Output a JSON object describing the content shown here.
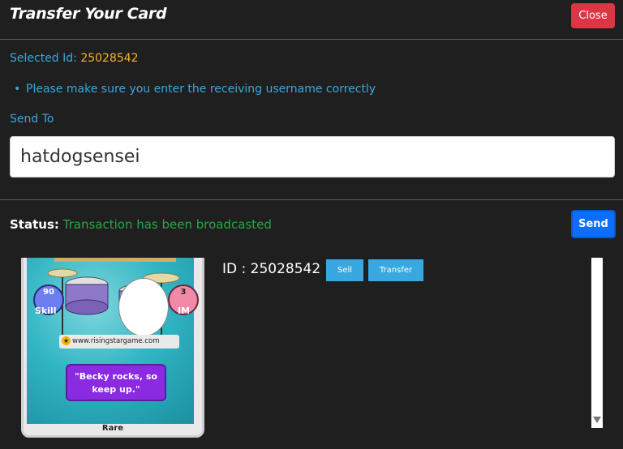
{
  "header": {
    "title": "Transfer Your Card",
    "close_label": "Close"
  },
  "form": {
    "selected_id_label": "Selected Id:",
    "selected_id_value": "25028542",
    "notice": "Please make sure you enter the receiving username correctly",
    "send_to_label": "Send To",
    "recipient_value": "hatdogsensei"
  },
  "footer": {
    "status_label": "Status:",
    "status_message": "Transaction has been broadcasted",
    "send_label": "Send"
  },
  "card": {
    "skill_value": "90",
    "skill_label": "Skill",
    "im_value": "3",
    "im_label": "IM",
    "website": "www.risingstargame.com",
    "quote": "\"Becky rocks, so keep up.\"",
    "rarity": "Rare"
  },
  "card_panel": {
    "id_text": "ID : 25028542",
    "sell_label": "Sell",
    "transfer_label": "Transfer"
  },
  "colors": {
    "accent_blue": "#3aa7dd",
    "id_highlight": "#f6b12a",
    "status_success": "#28a745",
    "close_red": "#dc3545",
    "send_blue": "#0d6efd"
  },
  "icons": [
    "star-icon",
    "scroll-down-icon"
  ]
}
